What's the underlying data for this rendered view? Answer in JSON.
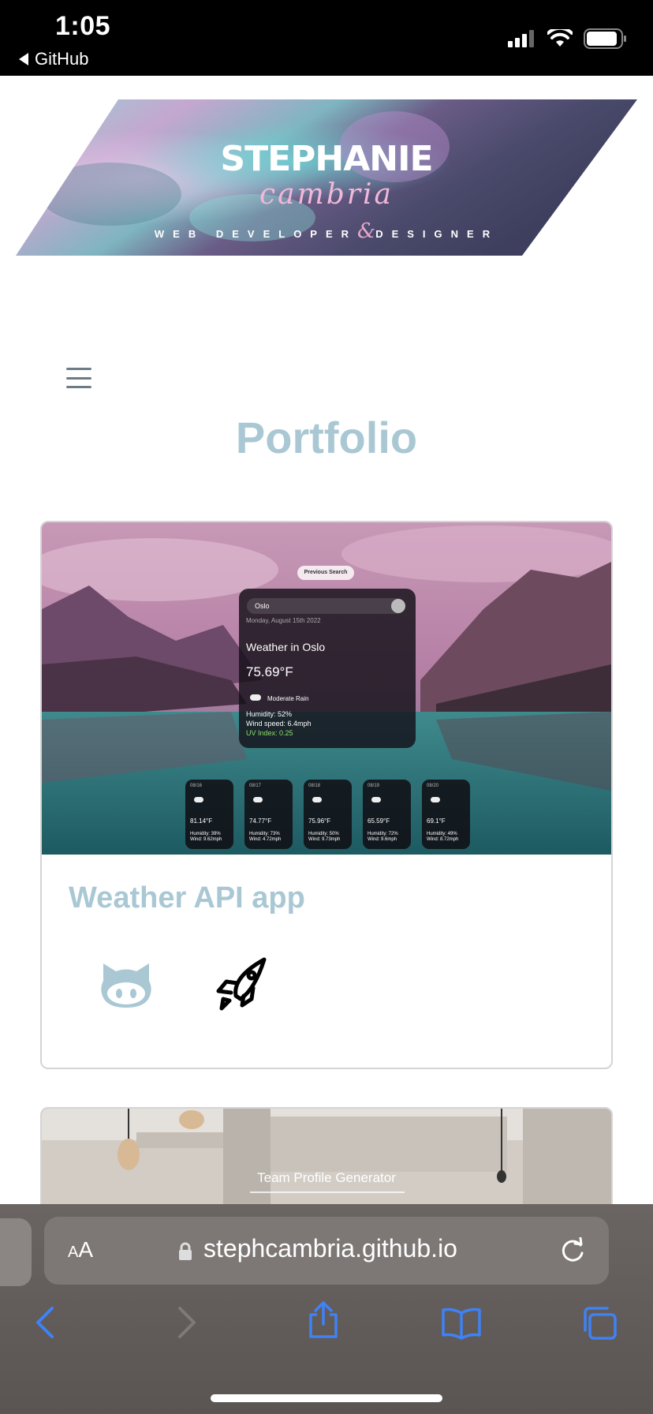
{
  "status_bar": {
    "time": "1:05",
    "back_label": "GitHub"
  },
  "banner": {
    "name": "STEPHANIE",
    "surname": "cambria",
    "role_part1": "WEB DEVELOPER",
    "amp": "&",
    "role_part2": "DESIGNER"
  },
  "page_title": "Portfolio",
  "projects": [
    {
      "title": "Weather API app",
      "preview": {
        "previous_search_label": "Previous Search",
        "search_value": "Oslo",
        "date": "Monday, August 15th 2022",
        "city_heading": "Weather in Oslo",
        "temperature": "75.69°F",
        "condition": "Moderate Rain",
        "humidity": "Humidity: 52%",
        "wind": "Wind speed: 6.4mph",
        "uv": "UV Index: 0.25",
        "forecast": [
          {
            "date": "08/16",
            "temp": "81.14°F",
            "humidity": "Humidity: 39%",
            "wind": "Wind: 9.62mph"
          },
          {
            "date": "08/17",
            "temp": "74.77°F",
            "humidity": "Humidity: 73%",
            "wind": "Wind: 4.72mph"
          },
          {
            "date": "08/18",
            "temp": "75.96°F",
            "humidity": "Humidity: 50%",
            "wind": "Wind: 9.73mph"
          },
          {
            "date": "08/19",
            "temp": "65.59°F",
            "humidity": "Humidity: 72%",
            "wind": "Wind: 9.6mph"
          },
          {
            "date": "08/20",
            "temp": "69.1°F",
            "humidity": "Humidity: 49%",
            "wind": "Wind: 8.72mph"
          }
        ]
      }
    },
    {
      "preview_caption": "Team Profile Generator"
    }
  ],
  "browser": {
    "aa_small": "A",
    "aa_large": "A",
    "url": "stephcambria.github.io"
  },
  "colors": {
    "accent": "#a9c8d4",
    "safari_link": "#3f82f5"
  }
}
